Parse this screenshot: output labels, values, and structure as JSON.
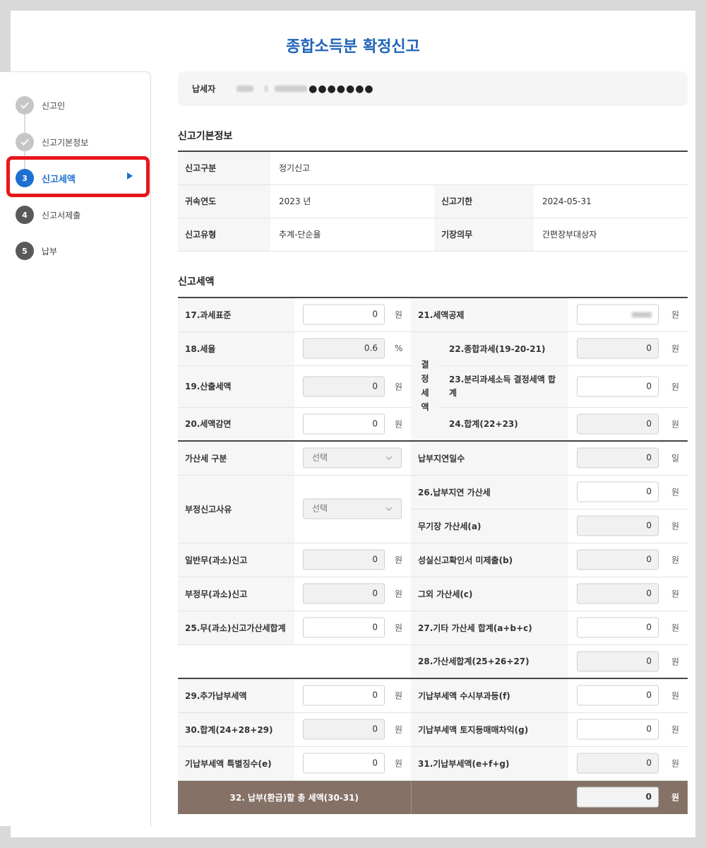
{
  "title": "종합소득분 확정신고",
  "steps": [
    {
      "num": "",
      "label": "신고인",
      "state": "done"
    },
    {
      "num": "",
      "label": "신고기본정보",
      "state": "done"
    },
    {
      "num": "3",
      "label": "신고세액",
      "state": "active"
    },
    {
      "num": "4",
      "label": "신고서제출",
      "state": "todo"
    },
    {
      "num": "5",
      "label": "납부",
      "state": "todo"
    }
  ],
  "taxpayer": {
    "label": "납세자",
    "masked_id": "●●●●●●●"
  },
  "basic": {
    "title": "신고기본정보",
    "report_type_label": "신고구분",
    "report_type": "정기신고",
    "year_label": "귀속연도",
    "year": "2023 년",
    "deadline_label": "신고기한",
    "deadline": "2024-05-31",
    "method_label": "신고유형",
    "method": "추계-단순율",
    "book_label": "기장의무",
    "book": "간편장부대상자"
  },
  "tax": {
    "title": "신고세액",
    "vertical_label": "결\n정\n세\n액",
    "unit_won": "원",
    "unit_pct": "%",
    "unit_day": "일",
    "select_placeholder": "선택",
    "r17": {
      "label": "17.과세표준",
      "value": "0"
    },
    "r18": {
      "label": "18.세율",
      "value": "0.6"
    },
    "r19": {
      "label": "19.산출세액",
      "value": "0"
    },
    "r20": {
      "label": "20.세액감면",
      "value": "0"
    },
    "r21": {
      "label": "21.세액공제"
    },
    "r22": {
      "label": "22.종합과세(19-20-21)",
      "value": "0"
    },
    "r23": {
      "label": "23.분리과세소득 결정세액 합계",
      "value": "0"
    },
    "r24": {
      "label": "24.합계(22+23)",
      "value": "0"
    },
    "penalty_type_label": "가산세 구분",
    "late_days_label": "납부지연일수",
    "late_days": "0",
    "fraud_reason_label": "부정신고사유",
    "r26": {
      "label": "26.납부지연 가산세",
      "value": "0"
    },
    "no_book": {
      "label": "무기장 가산세(a)",
      "value": "0"
    },
    "general_under": {
      "label": "일반무(과소)신고",
      "value": "0"
    },
    "faithful": {
      "label": "성실신고확인서 미제출(b)",
      "value": "0"
    },
    "fraud_under": {
      "label": "부정무(과소)신고",
      "value": "0"
    },
    "other": {
      "label": "그외 가산세(c)",
      "value": "0"
    },
    "r25": {
      "label": "25.무(과소)신고가산세합계",
      "value": "0"
    },
    "r27": {
      "label": "27.기타 가산세 합계(a+b+c)",
      "value": "0"
    },
    "r28": {
      "label": "28.가산세합계(25+26+27)",
      "value": "0"
    },
    "r29": {
      "label": "29.추가납부세액",
      "value": "0"
    },
    "prepaid_f": {
      "label": "기납부세액 수시부과등(f)",
      "value": "0"
    },
    "r30": {
      "label": "30.합계(24+28+29)",
      "value": "0"
    },
    "prepaid_g": {
      "label": "기납부세액 토지등매매차익(g)",
      "value": "0"
    },
    "prepaid_e": {
      "label": "기납부세액 특별징수(e)",
      "value": "0"
    },
    "r31": {
      "label": "31.기납부세액(e+f+g)",
      "value": "0"
    },
    "r32": {
      "label": "32. 납부(환급)할 총 세액(30-31)",
      "value": "0"
    }
  }
}
